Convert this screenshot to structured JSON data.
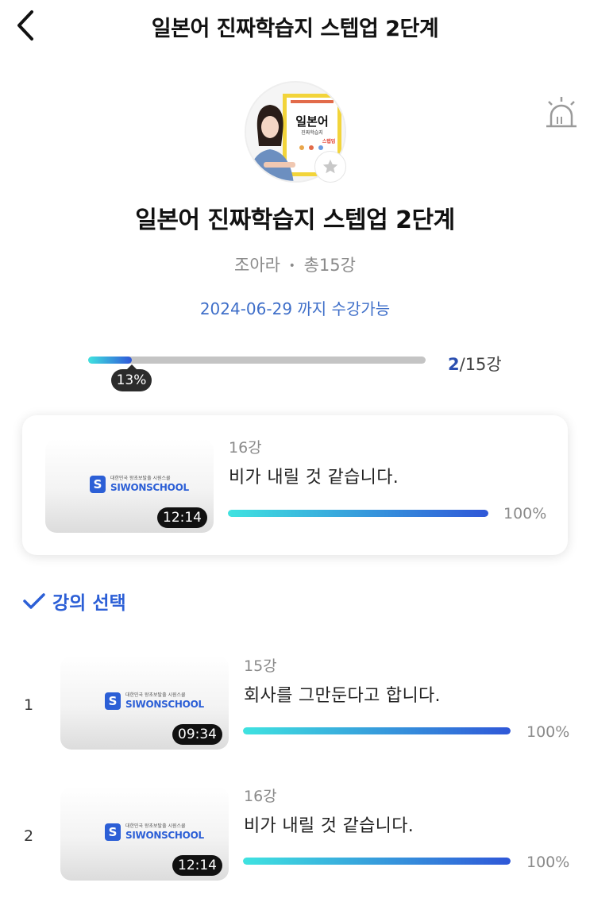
{
  "header": {
    "title": "일본어 진짜학습지 스텝업 2단계"
  },
  "course": {
    "title": "일본어 진짜학습지 스텝업 2단계",
    "cover_title": "일본어",
    "cover_subtitle": "진짜학습지",
    "cover_badge": "스텝업",
    "instructor": "조아라",
    "separator": "•",
    "total": "총15강",
    "period": "2024-06-29 까지 수강가능"
  },
  "progress": {
    "percent": 13,
    "percent_label": "13%",
    "done": "2",
    "total_label": "/15강"
  },
  "recent": {
    "number": "16강",
    "title": "비가 내릴 것 같습니다.",
    "duration": "12:14",
    "percent": 100,
    "percent_label": "100%"
  },
  "section": {
    "label": "강의 선택"
  },
  "logo": {
    "letter": "S",
    "small": "대한민국 왕초보탈출 시원스쿨",
    "big": "SIWONSCHOOL"
  },
  "lectures": [
    {
      "index": "1",
      "number": "15강",
      "title": "회사를 그만둔다고 합니다.",
      "duration": "09:34",
      "percent": 100,
      "percent_label": "100%"
    },
    {
      "index": "2",
      "number": "16강",
      "title": "비가 내릴 것 같습니다.",
      "duration": "12:14",
      "percent": 100,
      "percent_label": "100%"
    }
  ],
  "colors": {
    "accent": "#2c5fd6",
    "period": "#3f6fc9",
    "gradient_start": "#3fe3e0",
    "gradient_end": "#2f57d8"
  },
  "icons": {
    "back": "chevron-left-icon",
    "alarm": "alarm-light-icon",
    "favorite": "star-icon",
    "check": "check-icon"
  }
}
